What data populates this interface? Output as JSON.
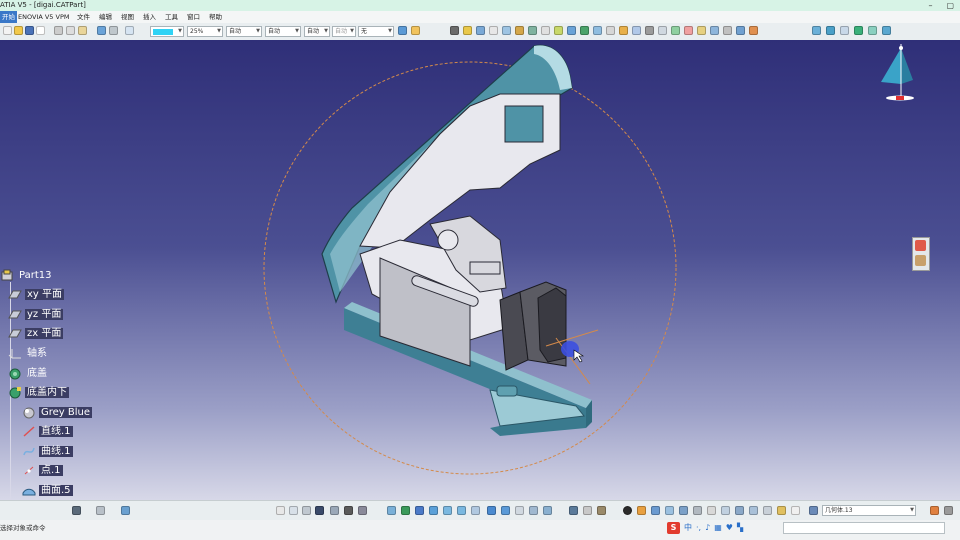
{
  "window": {
    "title": "ATIA V5 - [digai.CATPart]",
    "controls": [
      "–",
      "▢"
    ]
  },
  "menu": {
    "start": "开始",
    "items": [
      "ENOVIA V5 VPM",
      "文件",
      "编辑",
      "视图",
      "插入",
      "工具",
      "窗口",
      "帮助"
    ]
  },
  "toolbar": {
    "color_value": "",
    "transparency": "25%",
    "linetype": "自动",
    "lineweight": "自动",
    "layer": "自动",
    "point_type": "自动",
    "layer_filter": "无"
  },
  "tree": {
    "root": "Part13",
    "items": [
      {
        "label": "xy 平面",
        "icon": "plane-icon"
      },
      {
        "label": "yz 平面",
        "icon": "plane-icon"
      },
      {
        "label": "zx 平面",
        "icon": "plane-icon"
      },
      {
        "label": "轴系",
        "icon": "axis-system-icon"
      },
      {
        "label": "底盖",
        "icon": "body-icon"
      },
      {
        "label": "底盖内下",
        "icon": "geometrical-set-icon"
      },
      {
        "label": "Grey Blue",
        "icon": "material-icon"
      },
      {
        "label": "直线.1",
        "icon": "line-icon"
      },
      {
        "label": "曲线.1",
        "icon": "curve-icon"
      },
      {
        "label": "点.1",
        "icon": "point-icon"
      },
      {
        "label": "曲面.5",
        "icon": "surface-icon"
      }
    ]
  },
  "status": {
    "current_body": "几何体.13",
    "prompt": "选择对象或命令"
  },
  "ime": {
    "logo": "S",
    "mode": "中"
  },
  "colors": {
    "stapler_body": "#4f93a6",
    "stapler_light": "#8fc0cd",
    "mechanism": "#e8e8ee",
    "dark_part": "#4a4a52",
    "manipulator_circle": "#d48a4a",
    "background_top": "#2f2f78",
    "background_bottom": "#d7d8e8"
  }
}
